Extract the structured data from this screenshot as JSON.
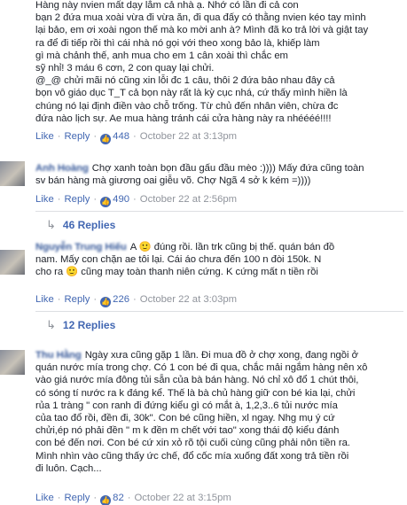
{
  "comments": [
    {
      "name": "",
      "text": "Hàng này nvien mất dạy lắm cả nhà ạ. Nhớ có lần đi cả con\nbạn 2 đứa mua xoài vừa đi vừa ăn, đi qua đấy có thằng nvien kéo tay mình\nlại bảo, em ơi xoài ngon thế mà ko mời anh à? Mình đã ko trả lời và giật tay\nra để đi tiếp rồi thì cái         nhà nó gọi với theo xong bảo là, khiếp làm\ngì mà chảnh thế, anh mua cho em 1 cân xoài thì chắc em \nsỹ nhỉ! 3 máu 6 cơn, 2 con quay lại chửi.\n@_@ chửi mãi nó cũng       xin lỗi đc 1 câu, thôi 2 đứa bảo nhau        đây cả\nbọn vô giáo dục T_T cả bọn này rất là kỳ cục nhá, cứ thấy mình hiền là\nchúng nó lại định điền vào chỗ trống. Từ chủ đến nhân viên,       chừa đc\nđứa nào lịch sự. Ae mua hàng tránh      cái cửa hàng này ra nhéééé!!!!",
      "like": "Like",
      "reply": "Reply",
      "likes": "448",
      "time": "October 22 at 3:13pm"
    },
    {
      "name": "Anh Hoàng",
      "text": "Chợ xanh toàn bọn đầu gấu đầu mèo :)))) Mấy đứa cũng toàn\nsv bán hàng mà giương oai giễu võ. Chợ Ngã 4 sở k kém =))))",
      "like": "Like",
      "reply": "Reply",
      "likes": "490",
      "time": "October 22 at 2:56pm",
      "replies": "46 Replies"
    },
    {
      "name": "Nguyễn Trung Hiếu",
      "text": "A 🙂 đúng rồi.       lần trk cũng bị thế.       quán bán đồ\nnam. Mấy con       chặn ae tôi lại. Cái áo chưa đến 100 n đòi 150k. N\n      cho ra 🙂 cũng may toàn thanh niên cứng. K cứng mất       n tiền rồi",
      "like": "Like",
      "reply": "Reply",
      "likes": "226",
      "time": "October 22 at 3:03pm",
      "replies": "12 Replies"
    },
    {
      "name": "Thu Hằng",
      "text": "Ngày xưa cũng gặp 1 lần. Đi mua đồ ở chợ xong, đang ngồi ở\nquán nước mía trong chợ. Có 1 con bé đi qua, chắc mải ngắm hàng nên xô\nvào giá nước mía đông tủi sẵn của bà bán hàng. Nó chỉ xô đổ 1 chút thôi,\ncó sóng tí nước ra k đáng kể. Thế là bà chủ hàng giữ con bé kia lại, chửi\nrủa 1 tràng \"      con ranh đi đứng kiểu gì      có mắt à, 1,2,3..6 tủi nước mía\ncủa tao đổ rồi, đền đi, 30k\". Con bé cũng hiền, xl ngay. Nhg mụ ý cứ\nchửi,ép nó phải đền \"     m k đền m chết với tao\" xong thái độ kiểu đánh\ncon bé đến nơi.  Con bé cứ xin xỏ rõ tội cuối cùng cũng phải nôn tiền ra.\nMình nhìn vào cũng thấy ức chế, đổ      cốc mía xuống đất xong trả tiền rồi\nđi luôn. Cạch...",
      "like": "Like",
      "reply": "Reply",
      "likes": "82",
      "time": "October 22 at 3:15pm"
    }
  ],
  "icons": {
    "like": "thumbs-up-icon",
    "reply": "reply-arrow-icon"
  },
  "colors": {
    "link": "#4267b2",
    "meta": "#90949c",
    "text": "#1d2129"
  }
}
